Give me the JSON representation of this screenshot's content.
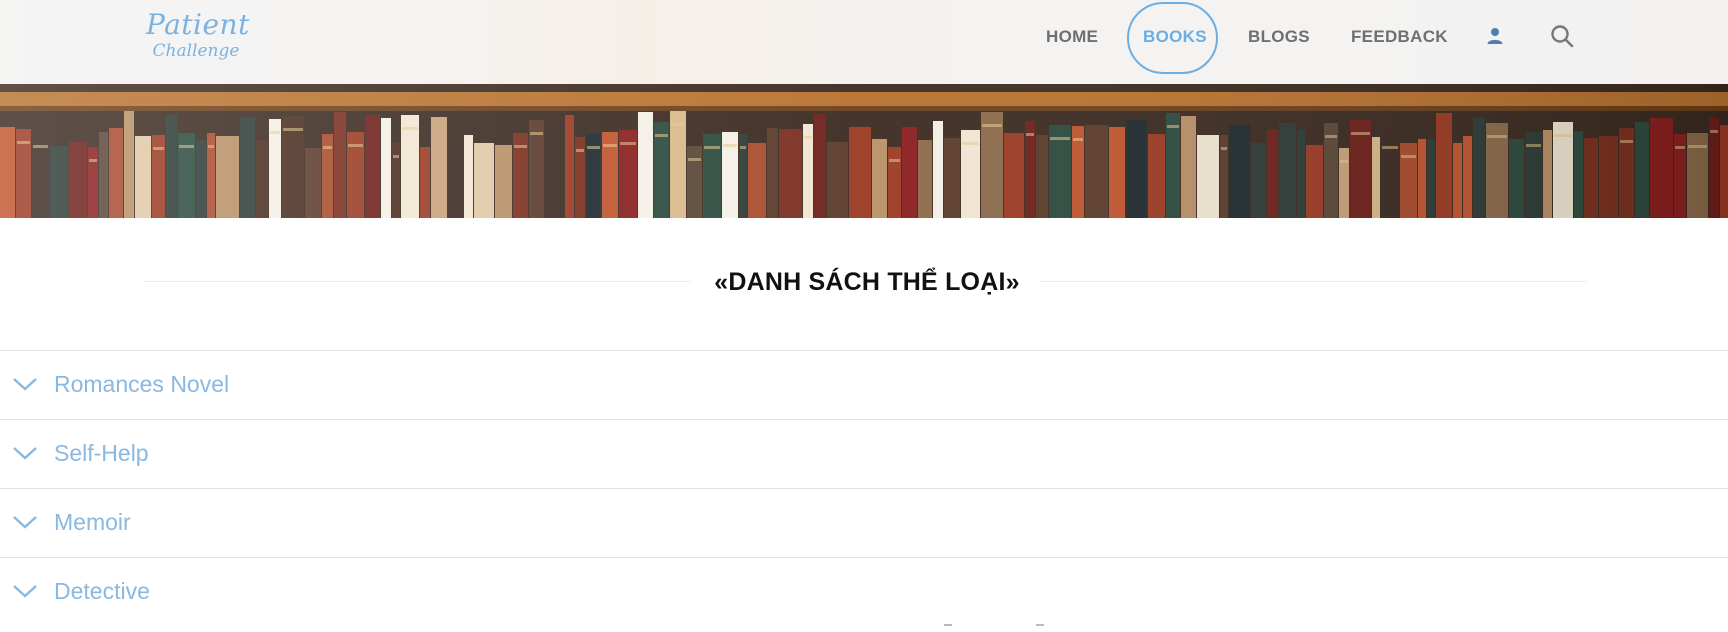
{
  "brand": {
    "logo_line1": "Patient",
    "logo_line2": "Challenge",
    "accent_color": "#6aaee4"
  },
  "nav": {
    "items": [
      {
        "label": "HOME",
        "active": false
      },
      {
        "label": "BOOKS",
        "active": true
      },
      {
        "label": "BLOGS",
        "active": false
      },
      {
        "label": "FEEDBACK",
        "active": false
      }
    ],
    "icons": [
      "user-icon",
      "search-icon"
    ]
  },
  "hero": {
    "image": "bookshelf-banner"
  },
  "section": {
    "title": "«DANH SÁCH THỂ LOẠI»"
  },
  "categories": [
    {
      "label": "Romances Novel",
      "icon": "chevron-down-icon"
    },
    {
      "label": "Self-Help",
      "icon": "chevron-down-icon"
    },
    {
      "label": "Memoir",
      "icon": "chevron-down-icon"
    },
    {
      "label": "Detective",
      "icon": "chevron-down-icon"
    }
  ]
}
